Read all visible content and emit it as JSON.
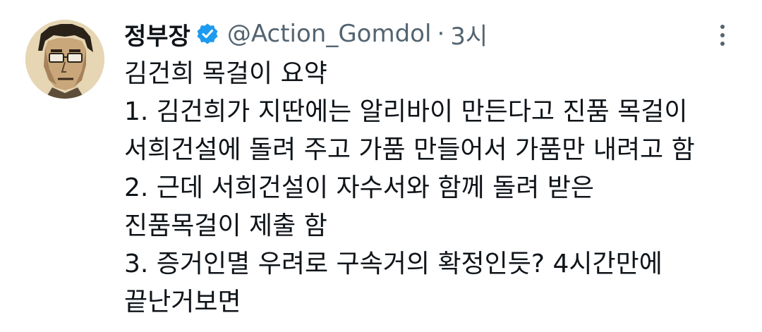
{
  "tweet": {
    "display_name": "정부장",
    "verified_icon": "verified-badge-icon",
    "handle": "@Action_Gomdol",
    "separator": "·",
    "time": "3시",
    "more_icon": "more-options-icon",
    "avatar": "user-avatar",
    "lines": [
      "김건희 목걸이 요약",
      "1. 김건희가 지딴에는 알리바이 만든다고 진품 목걸이",
      "서희건설에 돌려 주고 가품 만들어서 가품만 내려고 함",
      "2. 근데 서희건설이 자수서와 함께 돌려 받은",
      "진품목걸이 제출 함",
      "3. 증거인멸 우려로 구속거의 확정인듯? 4시간만에",
      "끝난거보면"
    ]
  },
  "colors": {
    "text": "#0f1419",
    "secondary": "#536471",
    "verified": "#1d9bf0"
  }
}
